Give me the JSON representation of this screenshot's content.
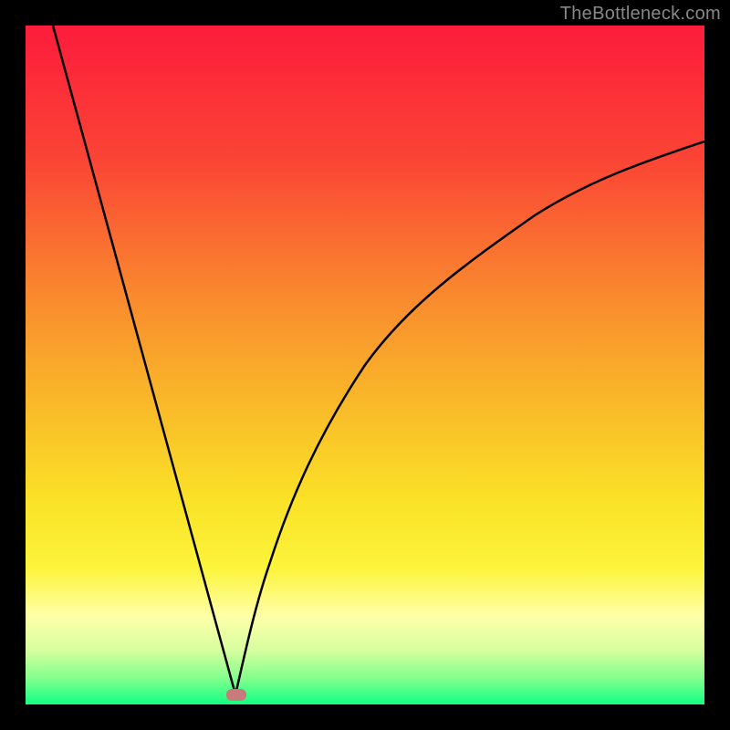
{
  "watermark": "TheBottleneck.com",
  "chart_data": {
    "type": "line",
    "title": "",
    "xlabel": "",
    "ylabel": "",
    "xlim": [
      0,
      100
    ],
    "ylim": [
      0,
      100
    ],
    "gradient": {
      "description": "Vertical gradient from red (top) through orange, yellow, pale yellow, to green (bottom)",
      "stops": [
        {
          "offset": 0,
          "color": "#fc1c3b"
        },
        {
          "offset": 20,
          "color": "#fb4535"
        },
        {
          "offset": 40,
          "color": "#f98a2e"
        },
        {
          "offset": 55,
          "color": "#f9b729"
        },
        {
          "offset": 70,
          "color": "#fae227"
        },
        {
          "offset": 80,
          "color": "#fcf43c"
        },
        {
          "offset": 87,
          "color": "#feffa8"
        },
        {
          "offset": 92,
          "color": "#d7ff9f"
        },
        {
          "offset": 96,
          "color": "#86ff8e"
        },
        {
          "offset": 100,
          "color": "#12ff83"
        }
      ]
    },
    "curve": {
      "description": "V-shaped curve with cusp minimum, steep linear left branch and concave right branch",
      "minimum_x": 31,
      "minimum_y": 98.5,
      "left_branch": [
        {
          "x": 4,
          "y": 0
        },
        {
          "x": 31,
          "y": 98.5
        }
      ],
      "right_branch": [
        {
          "x": 31,
          "y": 98.5
        },
        {
          "x": 33,
          "y": 90
        },
        {
          "x": 36,
          "y": 79
        },
        {
          "x": 40,
          "y": 68
        },
        {
          "x": 45,
          "y": 58
        },
        {
          "x": 50,
          "y": 50
        },
        {
          "x": 57,
          "y": 42
        },
        {
          "x": 65,
          "y": 35
        },
        {
          "x": 75,
          "y": 28
        },
        {
          "x": 85,
          "y": 23
        },
        {
          "x": 95,
          "y": 19
        },
        {
          "x": 100,
          "y": 17
        }
      ]
    },
    "marker": {
      "x": 31,
      "y": 98.5,
      "shape": "rounded-rect",
      "color": "#c77b7b"
    }
  }
}
